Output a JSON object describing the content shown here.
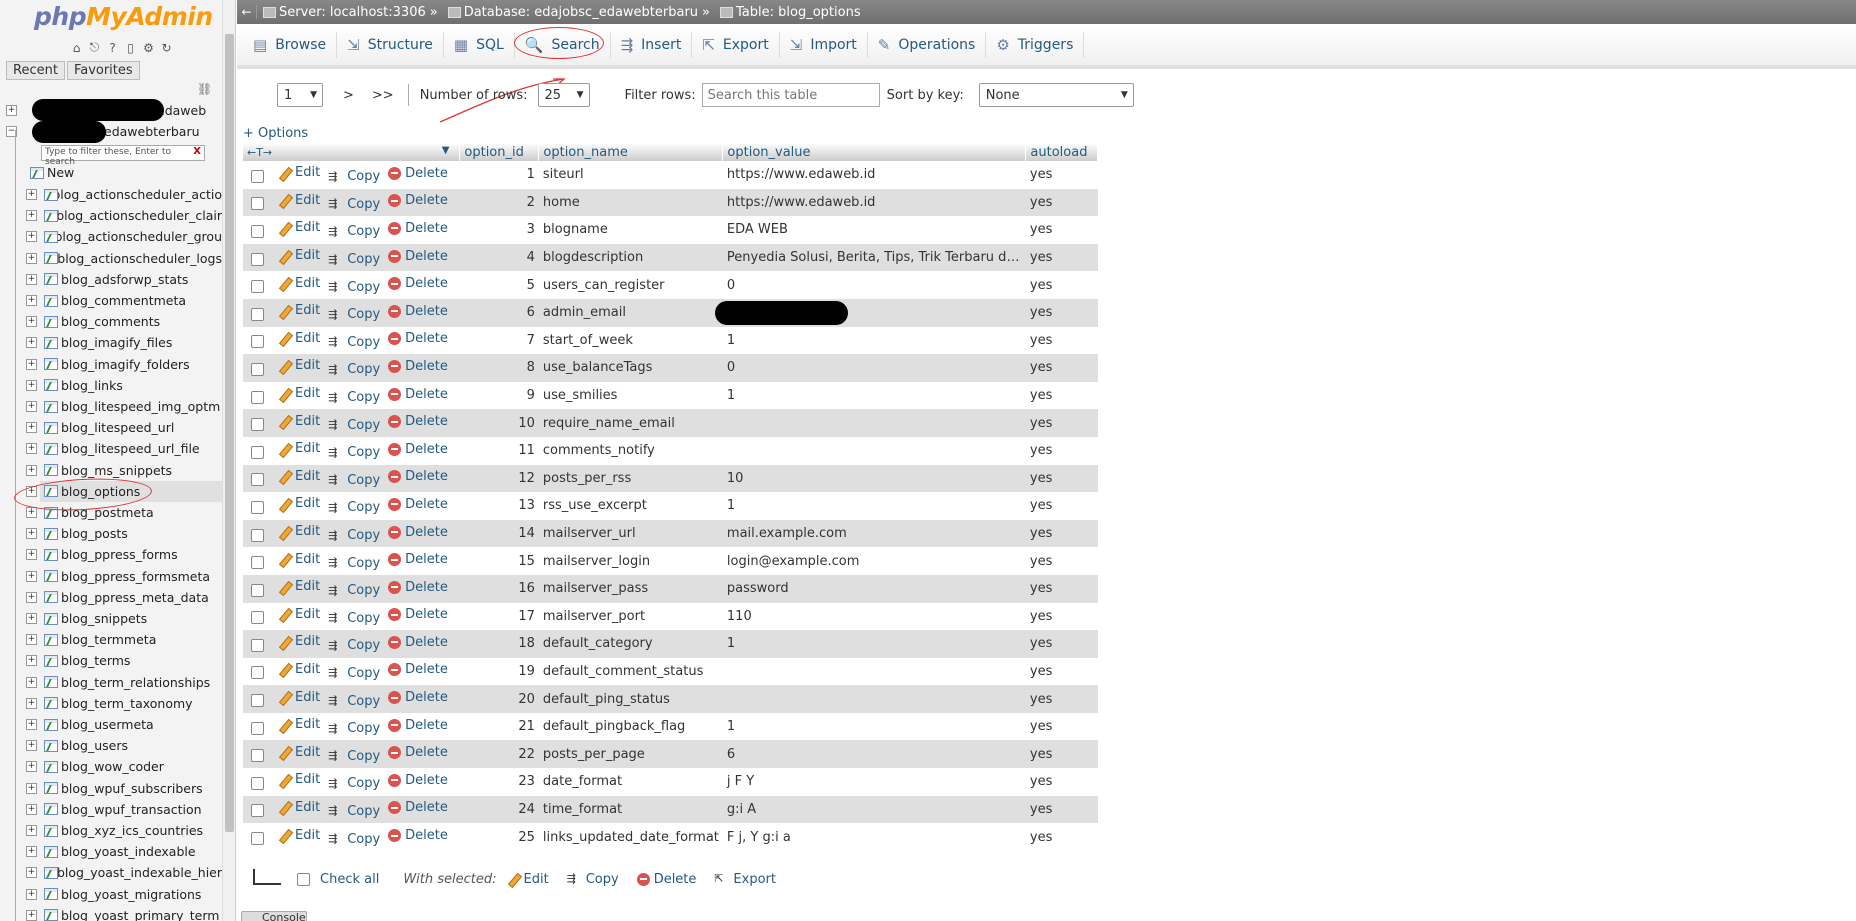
{
  "app": {
    "logo_php": "php",
    "logo_my": "My",
    "logo_admin": "Admin"
  },
  "sidebar": {
    "recent": "Recent",
    "favorites": "Favorites",
    "databases": [
      {
        "label": "edaweb",
        "redacted_prefix": true
      },
      {
        "label": "edawebterbaru",
        "redacted_prefix": true
      }
    ],
    "filter_placeholder": "Type to filter these, Enter to search",
    "filter_clear": "X",
    "new_label": "New",
    "tables": [
      "blog_actionscheduler_actio",
      "blog_actionscheduler_clair",
      "blog_actionscheduler_grou",
      "blog_actionscheduler_logs",
      "blog_adsforwp_stats",
      "blog_commentmeta",
      "blog_comments",
      "blog_imagify_files",
      "blog_imagify_folders",
      "blog_links",
      "blog_litespeed_img_optm",
      "blog_litespeed_url",
      "blog_litespeed_url_file",
      "blog_ms_snippets",
      "blog_options",
      "blog_postmeta",
      "blog_posts",
      "blog_ppress_forms",
      "blog_ppress_formsmeta",
      "blog_ppress_meta_data",
      "blog_snippets",
      "blog_termmeta",
      "blog_terms",
      "blog_term_relationships",
      "blog_term_taxonomy",
      "blog_usermeta",
      "blog_users",
      "blog_wow_coder",
      "blog_wpuf_subscribers",
      "blog_wpuf_transaction",
      "blog_xyz_ics_countries",
      "blog_yoast_indexable",
      "blog_yoast_indexable_hier",
      "blog_yoast_migrations",
      "blog_yoast_primary_term"
    ],
    "active_table": "blog_options"
  },
  "breadcrumb": {
    "server_label": "Server: localhost:3306",
    "database_label": "Database: edajobsc_edawebterbaru",
    "table_label": "Table: blog_options",
    "sep": "»"
  },
  "tabs": [
    {
      "label": "Browse",
      "icon": "browse-icon",
      "glyph": "▤"
    },
    {
      "label": "Structure",
      "icon": "structure-icon",
      "glyph": "⇲"
    },
    {
      "label": "SQL",
      "icon": "sql-icon",
      "glyph": "▦"
    },
    {
      "label": "Search",
      "icon": "search-icon",
      "glyph": "🔍"
    },
    {
      "label": "Insert",
      "icon": "insert-icon",
      "glyph": "⇶"
    },
    {
      "label": "Export",
      "icon": "export-icon",
      "glyph": "⇱"
    },
    {
      "label": "Import",
      "icon": "import-icon",
      "glyph": "⇲"
    },
    {
      "label": "Operations",
      "icon": "operations-icon",
      "glyph": "✎"
    },
    {
      "label": "Triggers",
      "icon": "triggers-icon",
      "glyph": "⚙"
    }
  ],
  "pager": {
    "page_value": "1",
    "next": ">",
    "last": ">>",
    "rows_label": "Number of rows:",
    "rows_value": "25",
    "filter_label": "Filter rows:",
    "filter_placeholder": "Search this table",
    "sort_label": "Sort by key:",
    "sort_value": "None"
  },
  "options_link": "+ Options",
  "table": {
    "headers": [
      "option_id",
      "option_name",
      "option_value",
      "autoload"
    ],
    "actions": {
      "edit": "Edit",
      "copy": "Copy",
      "delete": "Delete"
    },
    "rows": [
      {
        "id": "1",
        "name": "siteurl",
        "value": "https://www.edaweb.id",
        "autoload": "yes"
      },
      {
        "id": "2",
        "name": "home",
        "value": "https://www.edaweb.id",
        "autoload": "yes"
      },
      {
        "id": "3",
        "name": "blogname",
        "value": "EDA WEB",
        "autoload": "yes"
      },
      {
        "id": "4",
        "name": "blogdescription",
        "value": "Penyedia Solusi, Berita, Tips, Trik Terbaru dan Te...",
        "autoload": "yes"
      },
      {
        "id": "5",
        "name": "users_can_register",
        "value": "0",
        "autoload": "yes"
      },
      {
        "id": "6",
        "name": "admin_email",
        "value": "",
        "redacted": true,
        "autoload": "yes"
      },
      {
        "id": "7",
        "name": "start_of_week",
        "value": "1",
        "autoload": "yes"
      },
      {
        "id": "8",
        "name": "use_balanceTags",
        "value": "0",
        "autoload": "yes"
      },
      {
        "id": "9",
        "name": "use_smilies",
        "value": "1",
        "autoload": "yes"
      },
      {
        "id": "10",
        "name": "require_name_email",
        "value": "",
        "autoload": "yes"
      },
      {
        "id": "11",
        "name": "comments_notify",
        "value": "",
        "autoload": "yes"
      },
      {
        "id": "12",
        "name": "posts_per_rss",
        "value": "10",
        "autoload": "yes"
      },
      {
        "id": "13",
        "name": "rss_use_excerpt",
        "value": "1",
        "autoload": "yes"
      },
      {
        "id": "14",
        "name": "mailserver_url",
        "value": "mail.example.com",
        "autoload": "yes"
      },
      {
        "id": "15",
        "name": "mailserver_login",
        "value": "login@example.com",
        "autoload": "yes"
      },
      {
        "id": "16",
        "name": "mailserver_pass",
        "value": "password",
        "autoload": "yes"
      },
      {
        "id": "17",
        "name": "mailserver_port",
        "value": "110",
        "autoload": "yes"
      },
      {
        "id": "18",
        "name": "default_category",
        "value": "1",
        "autoload": "yes"
      },
      {
        "id": "19",
        "name": "default_comment_status",
        "value": "",
        "autoload": "yes"
      },
      {
        "id": "20",
        "name": "default_ping_status",
        "value": "",
        "autoload": "yes"
      },
      {
        "id": "21",
        "name": "default_pingback_flag",
        "value": "1",
        "autoload": "yes"
      },
      {
        "id": "22",
        "name": "posts_per_page",
        "value": "6",
        "autoload": "yes"
      },
      {
        "id": "23",
        "name": "date_format",
        "value": "j F Y",
        "autoload": "yes"
      },
      {
        "id": "24",
        "name": "time_format",
        "value": "g:i A",
        "autoload": "yes"
      },
      {
        "id": "25",
        "name": "links_updated_date_format",
        "value": "F j, Y g:i a",
        "autoload": "yes"
      }
    ]
  },
  "footer": {
    "check_all": "Check all",
    "with_selected": "With selected:",
    "edit": "Edit",
    "copy": "Copy",
    "delete": "Delete",
    "export": "Export"
  },
  "console": "Console",
  "colors": {
    "link": "#235a81",
    "row_alt": "#dfdfdf",
    "annotation": "#d33"
  }
}
